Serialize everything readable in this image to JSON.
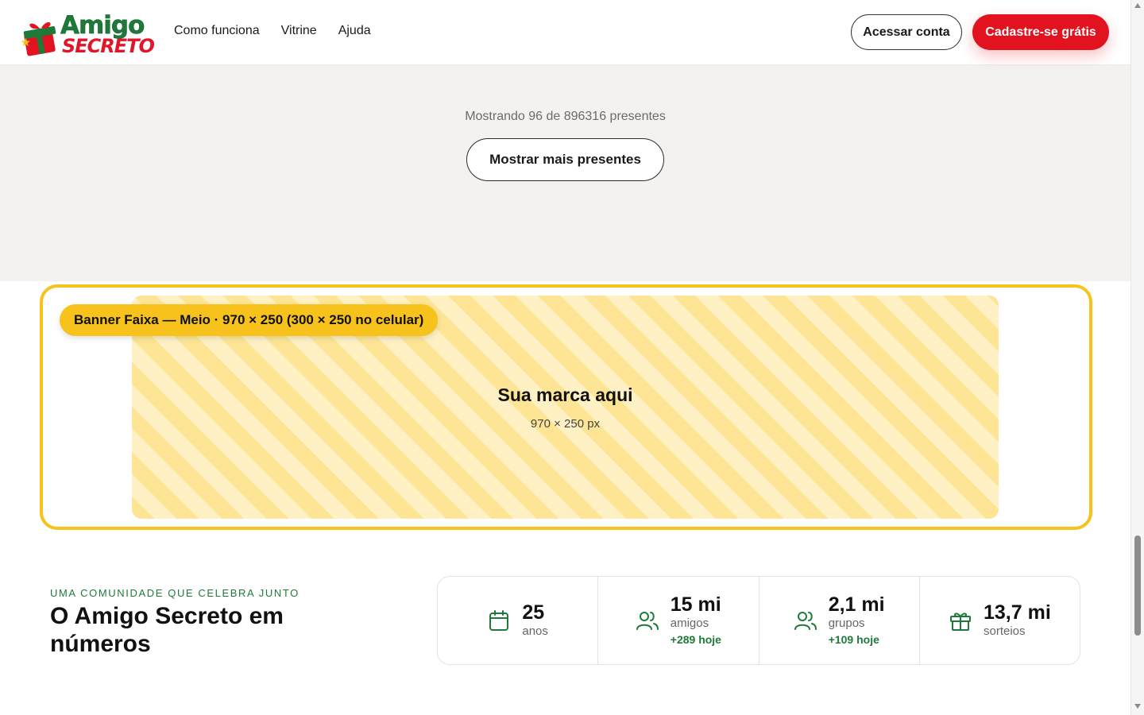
{
  "header": {
    "logo_line1": "Amigo",
    "logo_line2": "SECRETO",
    "nav": [
      "Como funciona",
      "Vitrine",
      "Ajuda"
    ],
    "login_label": "Acessar conta",
    "signup_label": "Cadastre-se grátis"
  },
  "gifts": {
    "showing_text": "Mostrando 96 de 896316 presentes",
    "more_label": "Mostrar mais presentes"
  },
  "banner": {
    "tag": "Banner Faixa — Meio · 970 × 250 (300 × 250 no celular)",
    "title": "Sua marca aqui",
    "size": "970 × 250 px"
  },
  "stats": {
    "eyebrow": "UMA COMUNIDADE QUE CELEBRA JUNTO",
    "title": "O Amigo Secreto em números",
    "items": [
      {
        "icon": "calendar-icon",
        "value": "25",
        "label": "anos",
        "today": ""
      },
      {
        "icon": "users-icon",
        "value": "15 mi",
        "label": "amigos",
        "today": "+289 hoje"
      },
      {
        "icon": "users-icon",
        "value": "2,1 mi",
        "label": "grupos",
        "today": "+109 hoje"
      },
      {
        "icon": "gift-icon",
        "value": "13,7 mi",
        "label": "sorteios",
        "today": ""
      }
    ]
  },
  "colors": {
    "brand_red": "#e3121f",
    "brand_green": "#1f7a3a",
    "banner_yellow": "#f6c21b"
  }
}
